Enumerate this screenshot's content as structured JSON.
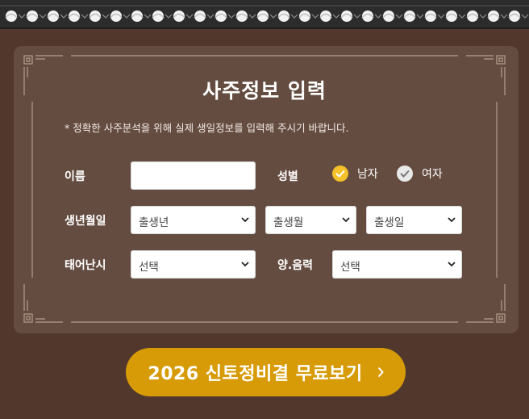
{
  "form": {
    "title": "사주정보 입력",
    "notice": "* 정확한 사주분석을 위해 실제 생일정보를 입력해 주시기 바랍니다.",
    "name": {
      "label": "이름",
      "value": ""
    },
    "gender": {
      "label": "성별",
      "options": [
        {
          "label": "남자",
          "checked": true
        },
        {
          "label": "여자",
          "checked": false
        }
      ]
    },
    "birthdate": {
      "label": "생년월일",
      "year": "출생년",
      "month": "출생월",
      "day": "출생일"
    },
    "birth_time": {
      "label": "태어난시",
      "value": "선택"
    },
    "calendar": {
      "label": "양.음력",
      "value": "선택"
    }
  },
  "cta": {
    "label": "2026 신토정비결 무료보기"
  },
  "colors": {
    "background": "#52382c",
    "card": "#644c40",
    "accent": "#d79b08",
    "radio_checked": "#f3c12a"
  },
  "icons": {
    "select_arrow": "chevron-down-icon",
    "cta_arrow": "chevron-right-icon",
    "radio_check": "check-icon"
  }
}
